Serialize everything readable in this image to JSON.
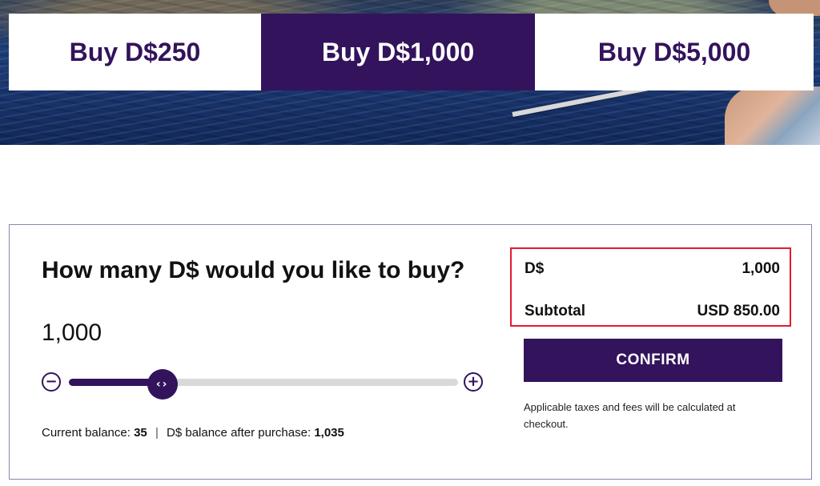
{
  "tabs": [
    {
      "label": "Buy D$250",
      "active": false
    },
    {
      "label": "Buy D$1,000",
      "active": true
    },
    {
      "label": "Buy D$5,000",
      "active": false
    }
  ],
  "purchase": {
    "question": "How many D$ would you like to buy?",
    "amount_display": "1,000",
    "slider_level": 0.24,
    "minus_icon": "minus-circle-icon",
    "plus_icon": "plus-circle-icon",
    "thumb_icon": "chevrons-left-right-icon",
    "current_balance_label": "Current balance:",
    "current_balance_value": "35",
    "separator": "|",
    "after_purchase_label": "D$ balance after purchase:",
    "after_purchase_value": "1,035"
  },
  "summary": {
    "currency_label": "D$",
    "currency_value": "1,000",
    "subtotal_label": "Subtotal",
    "subtotal_value": "USD 850.00"
  },
  "confirm_label": "CONFIRM",
  "tax_note": "Applicable taxes and fees will be calculated at checkout.",
  "colors": {
    "brand_purple": "#33135c",
    "highlight_red": "#e21c2c",
    "track_gray": "#d9d9d9"
  }
}
